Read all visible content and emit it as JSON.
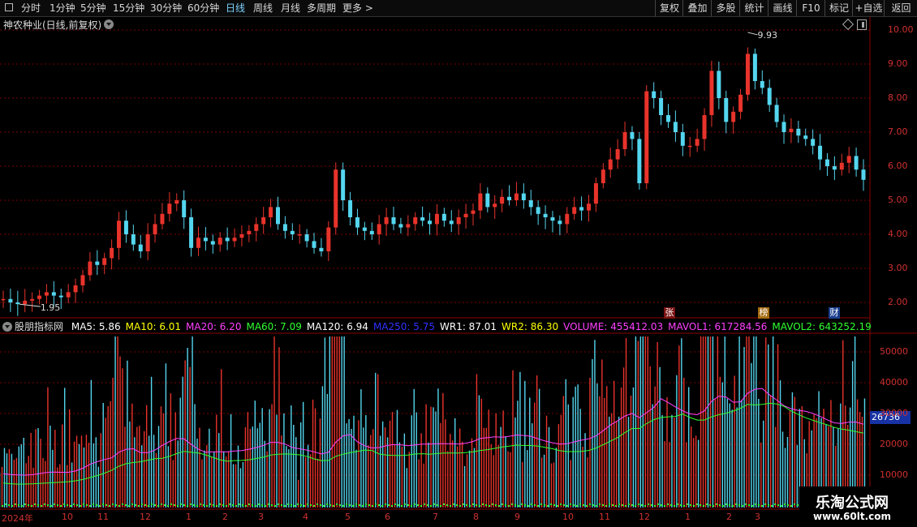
{
  "toolbar": {
    "periods": [
      {
        "label": "分时"
      },
      {
        "label": "1分钟"
      },
      {
        "label": "5分钟"
      },
      {
        "label": "15分钟"
      },
      {
        "label": "30分钟"
      },
      {
        "label": "60分钟"
      },
      {
        "label": "日线",
        "active": true
      },
      {
        "label": "周线"
      },
      {
        "label": "月线"
      },
      {
        "label": "多周期"
      },
      {
        "label": "更多 >"
      }
    ],
    "right_buttons": [
      {
        "label": "复权"
      },
      {
        "label": "叠加"
      },
      {
        "label": "多股"
      },
      {
        "label": "统计"
      },
      {
        "label": "画线"
      },
      {
        "label": "F10"
      },
      {
        "label": "标记"
      },
      {
        "label": "+自选"
      },
      {
        "label": "返回"
      }
    ]
  },
  "stock": {
    "title": "神农种业(日线,前复权)",
    "high_label": "9.93",
    "low_label": "1.95",
    "price_axis": [
      "10.00",
      "9.00",
      "8.00",
      "7.00",
      "6.00",
      "5.00",
      "4.00",
      "3.00",
      "2.00"
    ],
    "tags": {
      "zhang": "张",
      "bang": "榜",
      "cai": "财"
    }
  },
  "indicator": {
    "name": "股朋指标网",
    "items": [
      {
        "label": "MA5: 5.86",
        "color": "#ffffff"
      },
      {
        "label": "MA10: 6.01",
        "color": "#ffff00"
      },
      {
        "label": "MA20: 6.20",
        "color": "#ff40ff"
      },
      {
        "label": "MA60: 7.09",
        "color": "#30ff30"
      },
      {
        "label": "MA120: 6.94",
        "color": "#ffffff"
      },
      {
        "label": "MA250: 5.75",
        "color": "#3030ff"
      },
      {
        "label": "WR1: 87.01",
        "color": "#ffffff"
      },
      {
        "label": "WR2: 86.30",
        "color": "#ffff00"
      },
      {
        "label": "VOLUME: 455412.03",
        "color": "#ff40ff"
      },
      {
        "label": "MAVOL1: 617284.56",
        "color": "#ff40ff"
      },
      {
        "label": "MAVOL2: 643252.19",
        "color": "#30ff30"
      }
    ],
    "axis": [
      "50000",
      "40000",
      "30000",
      "20000",
      "10000"
    ],
    "highlight_value": "26736"
  },
  "time_axis": [
    "2024年",
    "10",
    "11",
    "12",
    "1",
    "2",
    "3",
    "4",
    "5",
    "6",
    "7",
    "8",
    "9",
    "10",
    "11",
    "12",
    "1",
    "2",
    "3"
  ],
  "watermark": {
    "title": "乐淘公式网",
    "url": "www.60lt.com"
  },
  "colors": {
    "up": "#e8332b",
    "down": "#54d6ef",
    "grid": "#7a0000",
    "axis_text": "#d03030"
  },
  "chart_data": {
    "type": "candlestick",
    "price_range": [
      1.7,
      10.3
    ],
    "close_series": [
      2.1,
      2.0,
      1.95,
      2.05,
      2.1,
      2.2,
      2.3,
      2.2,
      2.15,
      2.3,
      2.5,
      2.8,
      3.2,
      3.1,
      3.3,
      3.6,
      4.4,
      4.0,
      3.7,
      3.5,
      4.0,
      4.3,
      4.6,
      4.9,
      5.0,
      4.5,
      3.6,
      3.9,
      3.8,
      3.7,
      3.9,
      3.8,
      3.9,
      4.0,
      4.1,
      4.3,
      4.5,
      4.8,
      4.3,
      4.1,
      4.0,
      4.0,
      3.8,
      3.6,
      3.5,
      4.2,
      5.9,
      5.0,
      4.5,
      4.2,
      4.1,
      4.0,
      4.3,
      4.5,
      4.3,
      4.2,
      4.3,
      4.5,
      4.4,
      4.3,
      4.6,
      4.4,
      4.3,
      4.5,
      4.6,
      4.7,
      5.2,
      4.8,
      4.9,
      5.1,
      5.0,
      5.2,
      5.0,
      4.8,
      4.6,
      4.5,
      4.4,
      4.3,
      4.6,
      4.8,
      4.7,
      4.9,
      5.5,
      5.9,
      6.2,
      6.5,
      7.0,
      6.8,
      5.5,
      8.2,
      8.0,
      7.5,
      7.3,
      7.0,
      6.6,
      6.6,
      6.8,
      7.5,
      8.8,
      8.0,
      7.3,
      7.6,
      8.1,
      9.3,
      8.5,
      8.3,
      7.8,
      7.3,
      7.0,
      7.1,
      6.9,
      6.8,
      6.6,
      6.2,
      6.0,
      5.9,
      6.1,
      6.3,
      5.9,
      5.6
    ],
    "volume_max": 55000,
    "x_labels": [
      "2024年",
      "10",
      "11",
      "12",
      "1",
      "2",
      "3",
      "4",
      "5",
      "6",
      "7",
      "8",
      "9",
      "10",
      "11",
      "12",
      "1",
      "2",
      "3"
    ]
  }
}
